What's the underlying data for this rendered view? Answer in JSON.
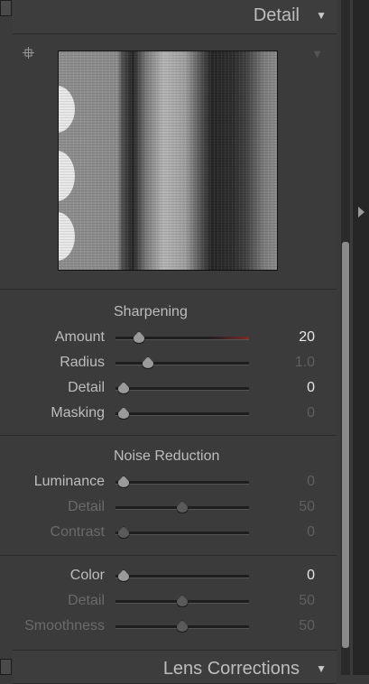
{
  "header": {
    "title": "Detail",
    "collapse_icon": "triangle-down"
  },
  "preview": {
    "target_icon": "crosshair",
    "expand_icon": "triangle-down"
  },
  "sharpening": {
    "title": "Sharpening",
    "sliders": [
      {
        "label": "Amount",
        "value": "20",
        "fraction": 0.18,
        "highlight": true
      },
      {
        "label": "Radius",
        "value": "1.0",
        "fraction": 0.25,
        "highlight": false
      },
      {
        "label": "Detail",
        "value": "0",
        "fraction": 0.0,
        "highlight": true
      },
      {
        "label": "Masking",
        "value": "0",
        "fraction": 0.0,
        "highlight": false
      }
    ]
  },
  "noise_reduction": {
    "title": "Noise Reduction",
    "luminance": [
      {
        "label": "Luminance",
        "value": "0",
        "fraction": 0.0
      },
      {
        "label": "Detail",
        "value": "50",
        "fraction": 0.5
      },
      {
        "label": "Contrast",
        "value": "0",
        "fraction": 0.0
      }
    ],
    "color": [
      {
        "label": "Color",
        "value": "0",
        "fraction": 0.0
      },
      {
        "label": "Detail",
        "value": "50",
        "fraction": 0.5
      },
      {
        "label": "Smoothness",
        "value": "50",
        "fraction": 0.5
      }
    ]
  },
  "next_panel": {
    "title": "Lens Corrections"
  }
}
